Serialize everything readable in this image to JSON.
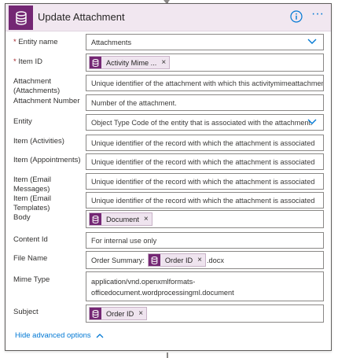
{
  "card": {
    "title": "Update Attachment",
    "header_icon": "database-icon",
    "info_icon": "info-icon",
    "more_label": "···",
    "accent": "#742774",
    "header_bg": "#f1e7f0"
  },
  "fields": {
    "entity_name": {
      "label": "Entity name",
      "required_mark": "*",
      "value": "Attachments"
    },
    "item_id": {
      "label": "Item ID",
      "required_mark": "*",
      "token": "Activity Mime ...",
      "remove": "×"
    },
    "attachment_attachments": {
      "label": "Attachment (Attachments)",
      "placeholder": "Unique identifier of the attachment with which this activitymimeattachment is a"
    },
    "attachment_number": {
      "label": "Attachment Number",
      "placeholder": "Number of the attachment."
    },
    "entity": {
      "label": "Entity",
      "placeholder": "Object Type Code of the entity that is associated with the attachment."
    },
    "item_activities": {
      "label": "Item (Activities)",
      "placeholder": "Unique identifier of the record with which the attachment is associated"
    },
    "item_appointments": {
      "label": "Item (Appointments)",
      "placeholder": "Unique identifier of the record with which the attachment is associated"
    },
    "item_email_messages": {
      "label": "Item (Email Messages)",
      "placeholder": "Unique identifier of the record with which the attachment is associated"
    },
    "item_email_templates": {
      "label": "Item (Email Templates)",
      "placeholder": "Unique identifier of the record with which the attachment is associated"
    },
    "body": {
      "label": "Body",
      "token": "Document",
      "remove": "×"
    },
    "content_id": {
      "label": "Content Id",
      "placeholder": "For internal use only"
    },
    "file_name": {
      "label": "File Name",
      "prefix": "Order Summary:",
      "token": "Order ID",
      "remove": "×",
      "suffix": ".docx"
    },
    "mime_type": {
      "label": "Mime Type",
      "line1": "application/vnd.openxmlformats-",
      "line2": "officedocument.wordprocessingml.document"
    },
    "subject": {
      "label": "Subject",
      "token": "Order ID",
      "remove": "×"
    }
  },
  "footer": {
    "advanced_label": "Hide advanced options"
  }
}
